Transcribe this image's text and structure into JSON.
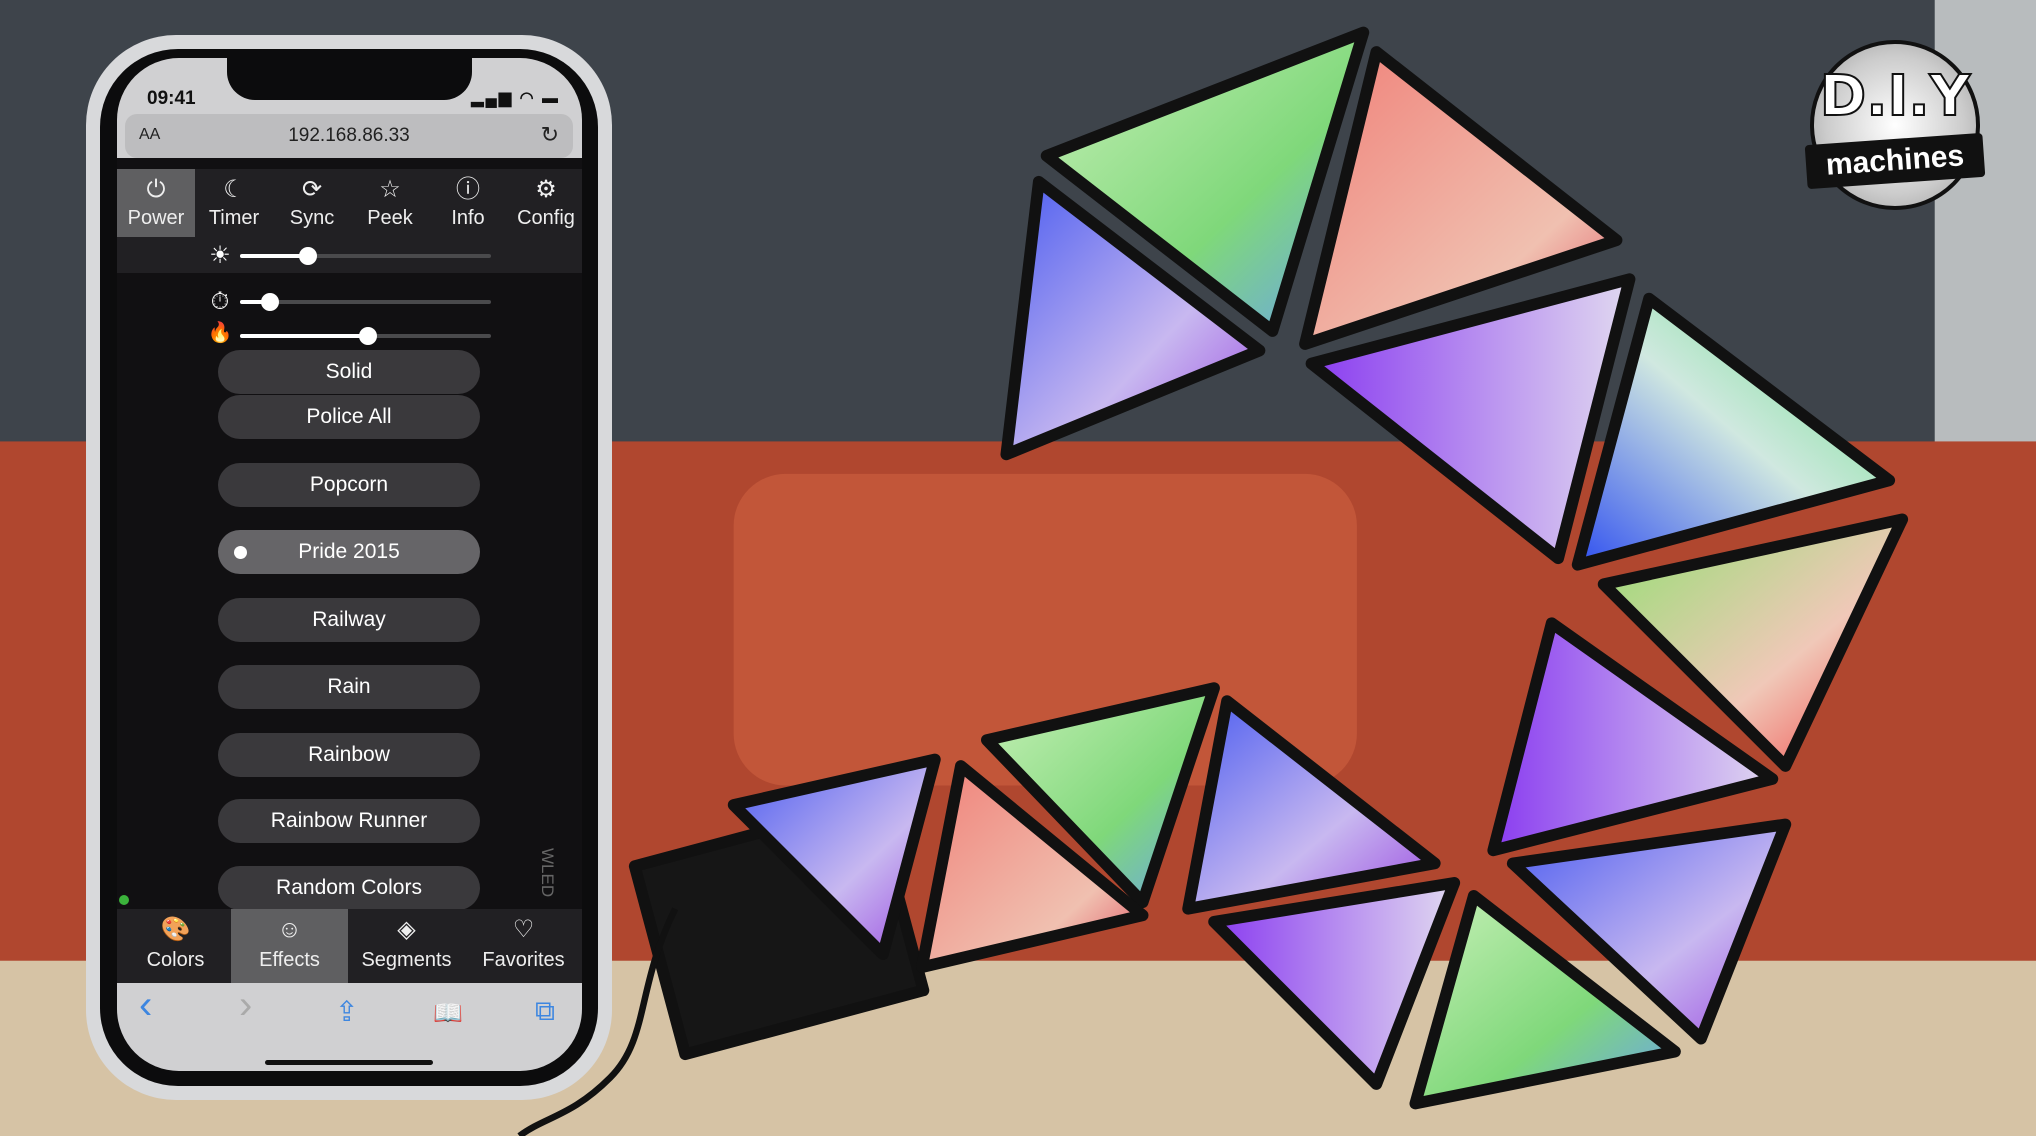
{
  "status_bar": {
    "time": "09:41",
    "icons": "signal wifi battery"
  },
  "browser": {
    "text_size_label": "AA",
    "url": "192.168.86.33",
    "reload_icon": "reload-icon"
  },
  "top_nav": {
    "items": [
      {
        "label": "Power",
        "icon": "⏻",
        "active": true
      },
      {
        "label": "Timer",
        "icon": "☾"
      },
      {
        "label": "Sync",
        "icon": "⟳"
      },
      {
        "label": "Peek",
        "icon": "☆"
      },
      {
        "label": "Info",
        "icon": "ⓘ"
      },
      {
        "label": "Config",
        "icon": "⚙"
      }
    ]
  },
  "sliders": {
    "brightness": {
      "icon": "☀",
      "value_pct": 27
    },
    "speed": {
      "icon": "⏱",
      "value_pct": 12
    },
    "intensity": {
      "icon": "🔥",
      "value_pct": 51
    }
  },
  "effects": [
    {
      "label": "Solid"
    },
    {
      "label": "Police All"
    },
    {
      "label": "Popcorn"
    },
    {
      "label": "Pride 2015",
      "selected": true
    },
    {
      "label": "Railway"
    },
    {
      "label": "Rain"
    },
    {
      "label": "Rainbow"
    },
    {
      "label": "Rainbow Runner"
    },
    {
      "label": "Random Colors"
    }
  ],
  "watermark": "WLED",
  "bottom_nav": {
    "items": [
      {
        "label": "Colors",
        "icon": "🎨"
      },
      {
        "label": "Effects",
        "icon": "☺",
        "active": true
      },
      {
        "label": "Segments",
        "icon": "◈"
      },
      {
        "label": "Favorites",
        "icon": "♡"
      }
    ]
  },
  "safari_toolbar": {
    "back": "‹",
    "forward": "›",
    "share": "⇪",
    "bookmarks": "📖",
    "tabs": "⧉"
  },
  "logo": {
    "line1": "D.I.Y",
    "line2": "machines"
  },
  "colors": {
    "accent_blue": "#3d86e0",
    "active_tab": "#5f5f61",
    "button": "#3a393c",
    "selected_button": "#666568",
    "status_dot": "#3bb33b"
  }
}
